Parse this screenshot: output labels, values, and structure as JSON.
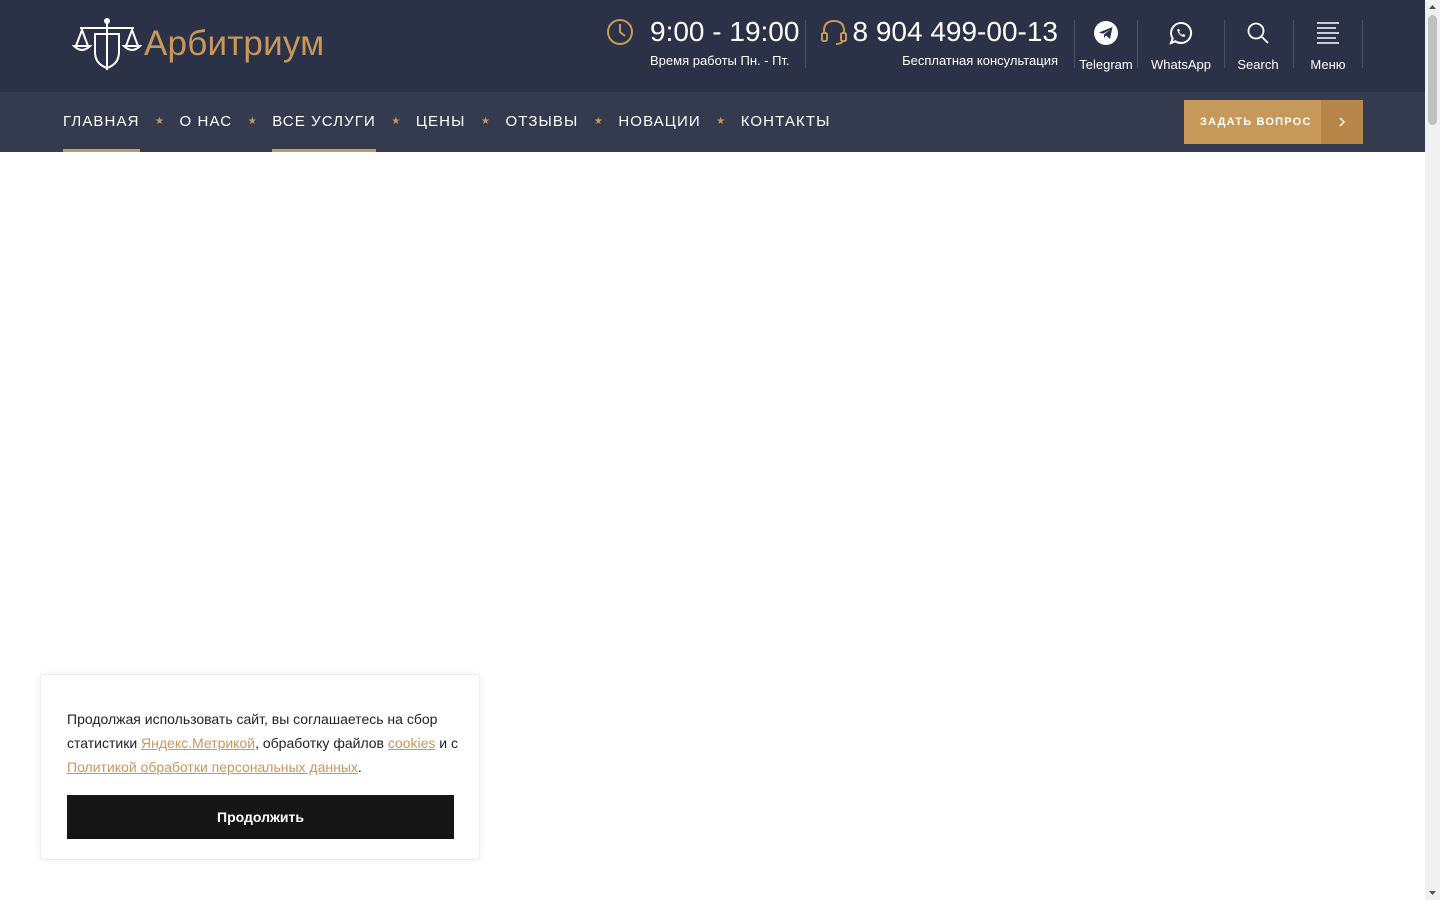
{
  "header": {
    "logo_text": "Арбитриум",
    "hours": {
      "time": "9:00 - 19:00",
      "caption": "Время работы Пн. - Пт."
    },
    "phone": {
      "number": "8 904 499-00-13",
      "caption": "Бесплатная консультация"
    },
    "buttons": [
      {
        "label": "Telegram",
        "icon": "telegram-icon"
      },
      {
        "label": "WhatsApp",
        "icon": "whatsapp-icon"
      },
      {
        "label": "Search",
        "icon": "search-icon"
      },
      {
        "label": "Меню",
        "icon": "menu-icon"
      }
    ]
  },
  "nav": {
    "items": [
      {
        "label": "ГЛАВНАЯ",
        "active": true
      },
      {
        "label": "О НАС",
        "active": false
      },
      {
        "label": "ВСЕ УСЛУГИ",
        "active": true
      },
      {
        "label": "ЦЕНЫ",
        "active": false
      },
      {
        "label": "ОТЗЫВЫ",
        "active": false
      },
      {
        "label": "НОВАЦИИ",
        "active": false
      },
      {
        "label": "КОНТАКТЫ",
        "active": false
      }
    ],
    "ask_button": "ЗАДАТЬ ВОПРОС"
  },
  "cookie": {
    "text_1": "Продолжая использовать сайт, вы соглашаетесь на сбор статистики ",
    "link_1": "Яндекс.Метрикой",
    "text_2": ", обработку файлов ",
    "link_2": "cookies",
    "text_3": " и с ",
    "link_3": "Политикой обработки персональных данных",
    "text_4": ".",
    "button": "Продолжить"
  },
  "colors": {
    "header_bg": "#2b3146",
    "nav_bg": "#353b4f",
    "accent": "#c8975a",
    "cookie_button": "#151515"
  }
}
